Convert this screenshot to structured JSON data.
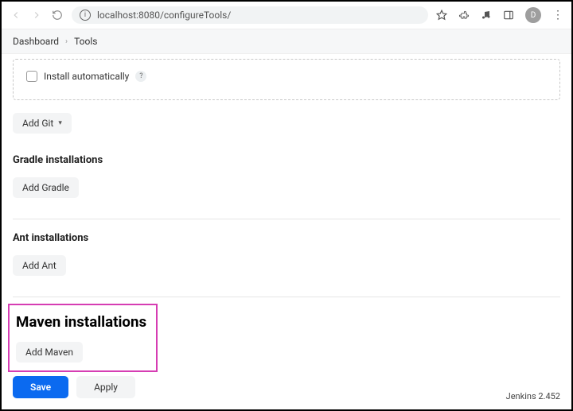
{
  "browser": {
    "url": "localhost:8080/configureTools/",
    "profile_initial": "D"
  },
  "breadcrumb": {
    "item1": "Dashboard",
    "item2": "Tools"
  },
  "git_panel": {
    "install_auto_label": "Install automatically",
    "add_button": "Add Git"
  },
  "gradle_section": {
    "heading": "Gradle installations",
    "add_button": "Add Gradle"
  },
  "ant_section": {
    "heading": "Ant installations",
    "add_button": "Add Ant"
  },
  "maven_section": {
    "heading": "Maven installations",
    "add_button": "Add Maven"
  },
  "footer": {
    "save": "Save",
    "apply": "Apply",
    "version": "Jenkins 2.452"
  }
}
